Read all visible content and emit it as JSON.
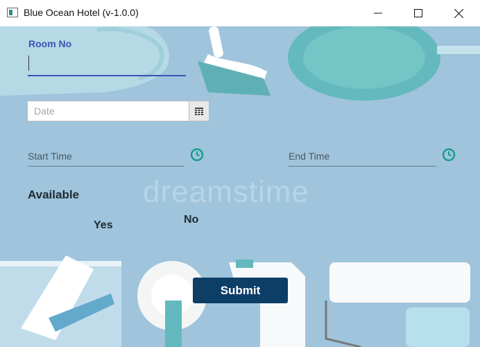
{
  "window": {
    "title": "Blue Ocean Hotel (v-1.0.0)",
    "controls": [
      "minimize-icon",
      "maximize-icon",
      "close-icon"
    ]
  },
  "form": {
    "room_no_label": "Room No",
    "room_no_value": "",
    "date_placeholder": "Date",
    "start_time_label": "Start Time",
    "end_time_label": "End Time",
    "available_label": "Available",
    "available_options": {
      "yes": "Yes",
      "no": "No"
    },
    "submit_label": "Submit"
  },
  "background": {
    "watermark": "dreamstime"
  },
  "colors": {
    "background": "#9fc4dc",
    "accent_label": "#3f51b5",
    "clock_icon": "#1a9a8e",
    "submit_button": "#0d3e66"
  },
  "icons": {
    "date_picker": "calendar-icon",
    "start_time": "clock-icon",
    "end_time": "clock-icon"
  }
}
